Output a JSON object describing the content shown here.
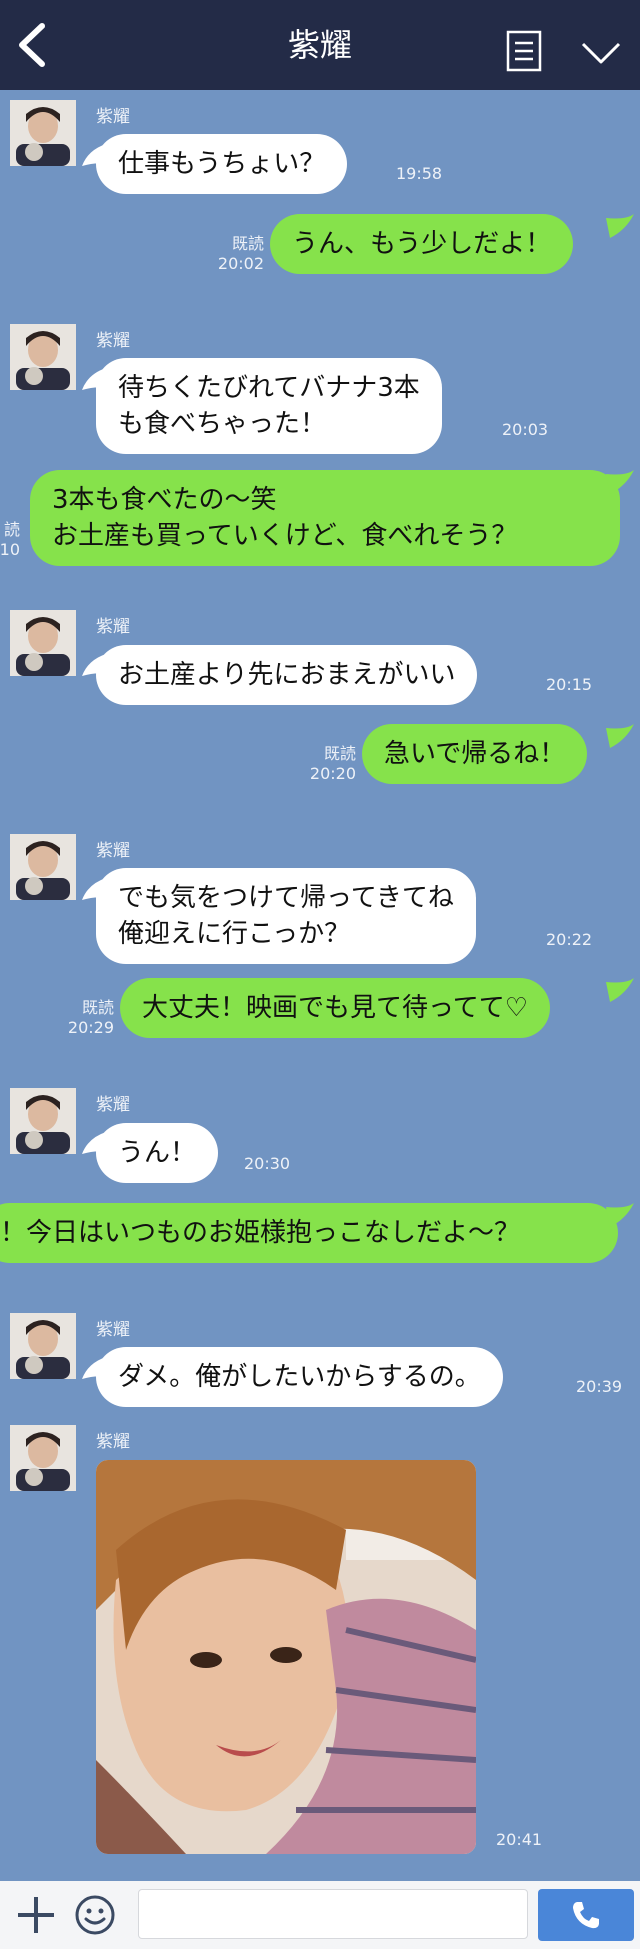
{
  "header": {
    "title": "紫耀"
  },
  "messages": [
    {
      "side": "in",
      "sender": "紫耀",
      "text": "仕事もうちょい？",
      "time": "19:58"
    },
    {
      "side": "out",
      "read": "既読",
      "text": "うん、もう少しだよ！",
      "time": "20:02"
    },
    {
      "side": "in",
      "sender": "紫耀",
      "lines": [
        "待ちくたびれてバナナ3本",
        "も食べちゃった！"
      ],
      "time": "20:03"
    },
    {
      "side": "out",
      "read": "読",
      "lines": [
        "3本も食べたの〜笑",
        "お土産も買っていくけど、食べれそう？"
      ],
      "time": ":10"
    },
    {
      "side": "in",
      "sender": "紫耀",
      "text": "お土産より先におまえがいい",
      "time": "20:15"
    },
    {
      "side": "out",
      "read": "既読",
      "text": "急いで帰るね！",
      "time": "20:20"
    },
    {
      "side": "in",
      "sender": "紫耀",
      "lines": [
        "でも気をつけて帰ってきてね",
        "俺迎えに行こっか？"
      ],
      "time": "20:22"
    },
    {
      "side": "out",
      "read": "既読",
      "text": "大丈夫！映画でも見て待ってて♡",
      "time": "20:29"
    },
    {
      "side": "in",
      "sender": "紫耀",
      "text": "うん！",
      "time": "20:30"
    },
    {
      "side": "out",
      "text": "！今日はいつものお姫様抱っこなしだよ〜？"
    },
    {
      "side": "in",
      "sender": "紫耀",
      "text": "ダメ。俺がしたいからするの。",
      "time": "20:39"
    },
    {
      "side": "in",
      "sender": "紫耀",
      "image": "photo",
      "time": "20:41"
    }
  ],
  "icons": {
    "back": "chevron-left-icon",
    "menu": "list-icon",
    "collapse": "chevron-down-icon",
    "add": "plus-icon",
    "emoji": "smile-icon",
    "call": "phone-icon"
  },
  "colors": {
    "header": "#232b47",
    "background": "#7194c2",
    "incoming_bubble": "#ffffff",
    "outgoing_bubble": "#86e24b",
    "call_button": "#4a86d8"
  },
  "footer": {
    "input_placeholder": ""
  }
}
